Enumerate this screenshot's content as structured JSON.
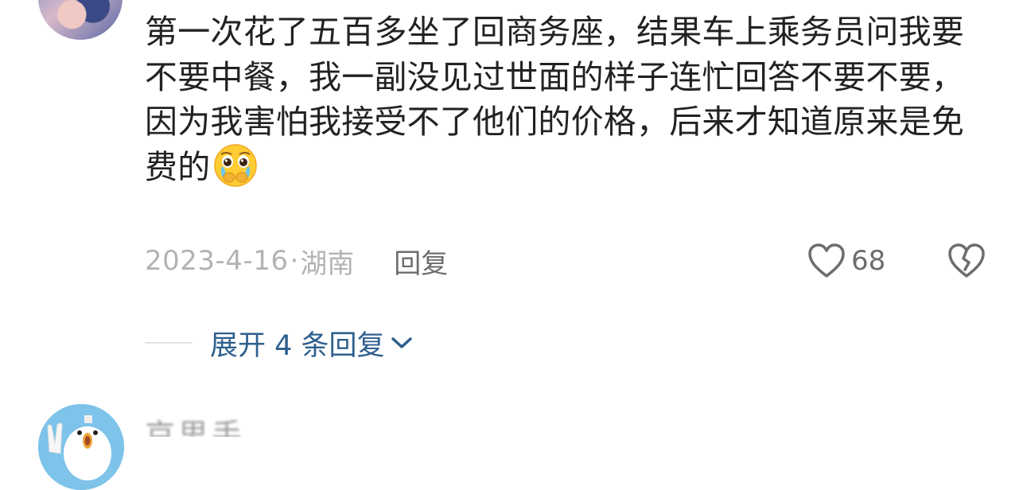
{
  "comment": {
    "text": "第一次花了五百多坐了回商务座，结果车上乘务员问我要不要中餐，我一副没见过世面的样子连忙回答不要不要，因为我害怕我接受不了他们的价格，后来才知道原来是免费的",
    "emoji": "pleading-face-emoji",
    "date": "2023-4-16",
    "separator": "·",
    "location": "湖南",
    "reply_label": "回复",
    "like_count": "68",
    "icons": {
      "like": "heart-icon",
      "dislike": "broken-heart-icon"
    }
  },
  "replies": {
    "expand_label": "展开 4 条回复"
  },
  "next_comment": {
    "username": "京思手"
  },
  "colors": {
    "text": "#222222",
    "meta": "#b3b3b3",
    "action": "#6d6d6d",
    "link": "#2e5f8e",
    "divider": "#e3e3e3"
  }
}
